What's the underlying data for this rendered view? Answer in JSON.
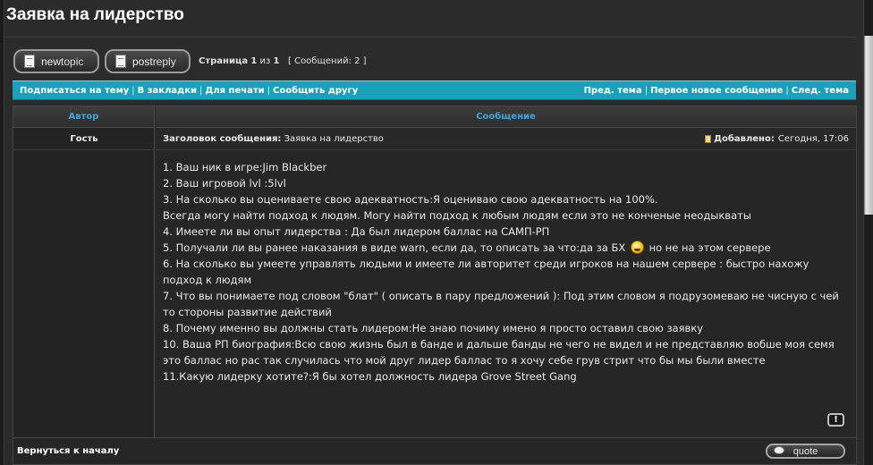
{
  "page": {
    "title": "Заявка на лидерство"
  },
  "buttons": {
    "new_topic_prefix": "new",
    "new_topic_suffix": "topic",
    "post_reply_prefix": "post",
    "post_reply_suffix": "reply"
  },
  "pagination": {
    "label": "Страница",
    "current": "1",
    "of": "из",
    "total": "1",
    "messages": "[ Сообщений: 2 ]"
  },
  "action_bar": {
    "left": [
      "Подписаться на тему",
      "В закладки",
      "Для печати",
      "Сообщить другу"
    ],
    "right": [
      "Пред. тема",
      "Первое новое сообщение",
      "След. тема"
    ]
  },
  "table": {
    "header_author": "Автор",
    "header_message": "Сообщение"
  },
  "post": {
    "author": "Гость",
    "subject_label": "Заголовок сообщения:",
    "subject": "Заявка на лидерство",
    "posted_label": "Добавлено:",
    "posted_time": "Сегодня, 17:06",
    "lines": [
      "1. Ваш ник в игре:Jim Blackber",
      "2. Ваш игровой lvl :5lvl",
      "3. На сколько вы оцениваете свою адекватность:Я оцениваю свою адекватность на 100%.",
      "Всегда могу найти подход к людям. Могу найти подход к любым людям если это не конченые неодыкваты",
      "4. Имеете ли вы опыт лидерства : Да был лидером баллас на САМП-РП"
    ],
    "line5_before": "5. Получали ли вы ранее наказания в виде warn, если да, то описать за что:да за БХ",
    "line5_after": "но не на этом сервере",
    "lines_after": [
      "6. На сколько вы умеете управлять людьми и имеете ли авторитет среди игроков на нашем сервере : быстро нахожу подход к людям",
      "7. Что вы понимаете под словом \"блат\" ( описать в пару предложений ): Под этим словом я подрузомеваю не чисную с чей то стороны развитие действий",
      "8. Почему именно вы должны стать лидером:Не знаю почиму имено я просто оставил свою заявку",
      "10. Ваша РП биография:Всю свою жизнь был в банде и дальше банды не чего не видел и не представляю вобше моя семя это баллас но рас так случилась что мой друг лидер баллас то я хочу себе грув стрит что бы мы были вместе",
      "11.Какую лидерку хотите?:Я бы хотел должность лидера Grove Street Gang"
    ],
    "report_glyph": "!"
  },
  "footer": {
    "back_to_top": "Вернуться к началу",
    "quote": "quote"
  },
  "icons": {
    "new_topic": "document-icon",
    "post_reply": "document-icon",
    "post": "post-icon",
    "smiley": "laughing-smiley-icon",
    "report": "report-icon",
    "quote": "speech-bubble-icon"
  },
  "colors": {
    "accent_bar": "#1aa0b8",
    "header_text": "#3fa6d8",
    "background": "#2b2b2b"
  }
}
